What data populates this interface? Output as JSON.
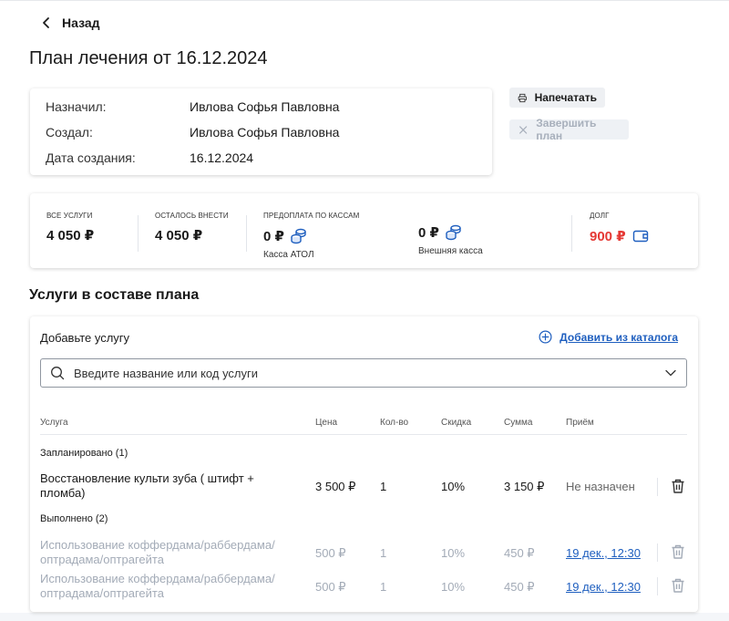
{
  "nav": {
    "back_label": "Назад"
  },
  "page": {
    "title": "План лечения от 16.12.2024"
  },
  "info": {
    "assigned_label": "Назначил:",
    "assigned_value": "Ивлова Софья Павловна",
    "created_by_label": "Создал:",
    "created_by_value": "Ивлова Софья Павловна",
    "created_date_label": "Дата создания:",
    "created_date_value": "16.12.2024"
  },
  "actions": {
    "print_label": "Напечатать",
    "finish_label": "Завершить план"
  },
  "stats": {
    "all_services_caption": "Все услуги",
    "all_services_value": "4 050 ₽",
    "remaining_caption": "Осталось внести",
    "remaining_value": "4 050 ₽",
    "prepay_caption": "Предоплата по кассам",
    "atol_value": "0 ₽",
    "atol_label": "Касса АТОЛ",
    "external_value": "0 ₽",
    "external_label": "Внешняя касса",
    "debt_caption": "Долг",
    "debt_value": "900 ₽"
  },
  "services": {
    "section_title": "Услуги в составе плана",
    "add_label": "Добавьте услугу",
    "catalog_link": "Добавить из каталога",
    "search_placeholder": "Введите название или код услуги",
    "columns": {
      "service": "Услуга",
      "price": "Цена",
      "qty": "Кол-во",
      "discount": "Скидка",
      "sum": "Сумма",
      "visit": "Приём"
    },
    "planned_group": "Запланировано (1)",
    "planned": [
      {
        "name": "Восстановление культи зуба ( штифт + пломба)",
        "price": "3 500 ₽",
        "qty": "1",
        "discount": "10%",
        "sum": "3 150 ₽",
        "visit": "Не назначен"
      }
    ],
    "done_group": "Выполнено (2)",
    "done": [
      {
        "name": "Использование коффердама/раббердама/оптрадама/оптрагейта",
        "price": "500 ₽",
        "qty": "1",
        "discount": "10%",
        "sum": "450 ₽",
        "visit": "19 дек., 12:30"
      },
      {
        "name": "Использование коффердама/раббердама/оптрадама/оптрагейта",
        "price": "500 ₽",
        "qty": "1",
        "discount": "10%",
        "sum": "450 ₽",
        "visit": "19 дек., 12:30"
      }
    ]
  },
  "colors": {
    "accent": "#1f5fbf",
    "debt": "#e53935",
    "muted": "#a3abb7"
  }
}
